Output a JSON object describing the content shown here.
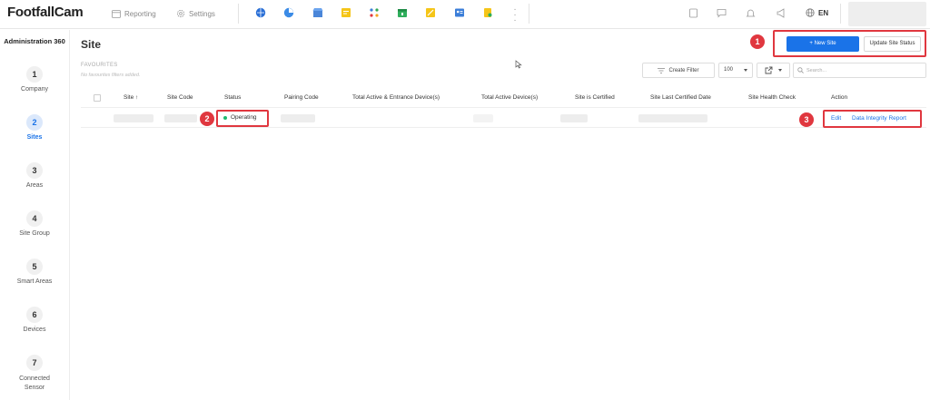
{
  "app": {
    "logo": "FootfallCam",
    "nav": {
      "reporting": "Reporting",
      "settings": "Settings"
    },
    "language": "EN"
  },
  "sidebar": {
    "title": "Administration 360",
    "steps": [
      {
        "num": "1",
        "label": "Company"
      },
      {
        "num": "2",
        "label": "Sites"
      },
      {
        "num": "3",
        "label": "Areas"
      },
      {
        "num": "4",
        "label": "Site Group"
      },
      {
        "num": "5",
        "label": "Smart Areas"
      },
      {
        "num": "6",
        "label": "Devices"
      },
      {
        "num": "7",
        "label": "Connected Sensor"
      }
    ]
  },
  "page": {
    "title": "Site",
    "favourites_label": "FAVOURITES",
    "favourites_empty": "No favourites filters added.",
    "new_site": "+ New Site",
    "update_status": "Update Site Status",
    "create_filter": "Create Filter",
    "page_size": "100",
    "search_placeholder": "Search..."
  },
  "annotations": {
    "one": "1",
    "two": "2",
    "three": "3",
    "color": "#e0373f"
  },
  "table": {
    "headers": {
      "site": "Site ↑",
      "site_code": "Site Code",
      "status": "Status",
      "pairing_code": "Pairing Code",
      "total_active_entrance": "Total Active & Entrance Device(s)",
      "total_active": "Total Active Device(s)",
      "certified": "Site is Certified",
      "last_certified": "Site Last Certified Date",
      "health_check": "Site Health Check",
      "action": "Action"
    },
    "row": {
      "status": "Operating",
      "edit": "Edit",
      "report": "Data Integrity Report"
    }
  },
  "colors": {
    "accent": "#1a73e8",
    "status_ok": "#1fb96e"
  }
}
